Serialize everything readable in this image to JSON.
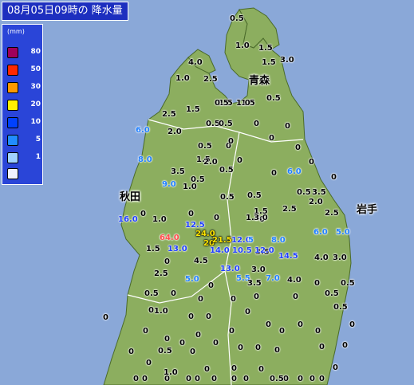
{
  "title": "08月05日09時の 降水量",
  "legend": {
    "unit": "(mm)",
    "items": [
      {
        "label": "80",
        "color": "#a0005a"
      },
      {
        "label": "50",
        "color": "#ff2800"
      },
      {
        "label": "30",
        "color": "#ff9900"
      },
      {
        "label": "20",
        "color": "#fff000"
      },
      {
        "label": "10",
        "color": "#0041ff"
      },
      {
        "label": "5",
        "color": "#218cff"
      },
      {
        "label": "1",
        "color": "#a0d2ff"
      },
      {
        "label": "",
        "color": "#f2f2ff"
      }
    ]
  },
  "places": [
    {
      "name": "青森"
    },
    {
      "name": "秋田"
    },
    {
      "name": "岩手"
    }
  ],
  "observations": [
    {
      "v": "0.5"
    },
    {
      "v": "1.0"
    },
    {
      "v": "1.5"
    },
    {
      "v": "3.0"
    },
    {
      "v": "4.0"
    },
    {
      "v": "1.5"
    },
    {
      "v": "1.0"
    },
    {
      "v": "2.5"
    },
    {
      "v": "0"
    },
    {
      "v": "1.5"
    },
    {
      "v": "2.5"
    },
    {
      "v": "1.5"
    },
    {
      "v": "1.5"
    },
    {
      "v": "0.5"
    },
    {
      "v": "1.0"
    },
    {
      "v": "0.5"
    },
    {
      "v": "0.5"
    },
    {
      "v": "0.5"
    },
    {
      "v": "0"
    },
    {
      "v": "6.0"
    },
    {
      "v": "2.0"
    },
    {
      "v": "0.5"
    },
    {
      "v": "0"
    },
    {
      "v": "0"
    },
    {
      "v": "0"
    },
    {
      "v": "0"
    },
    {
      "v": "8.0"
    },
    {
      "v": "1.5"
    },
    {
      "v": "0"
    },
    {
      "v": "2.0"
    },
    {
      "v": "0.5"
    },
    {
      "v": "0"
    },
    {
      "v": "3.5"
    },
    {
      "v": "9.0"
    },
    {
      "v": "1.0"
    },
    {
      "v": "0.5"
    },
    {
      "v": "0"
    },
    {
      "v": "6.0"
    },
    {
      "v": "0"
    },
    {
      "v": "0.5"
    },
    {
      "v": "0.5"
    },
    {
      "v": "0.5"
    },
    {
      "v": "3.5"
    },
    {
      "v": "2.0"
    },
    {
      "v": "0"
    },
    {
      "v": "0"
    },
    {
      "v": "1.5"
    },
    {
      "v": "2.5"
    },
    {
      "v": "2.5"
    },
    {
      "v": "0"
    },
    {
      "v": "1.3"
    },
    {
      "v": "3.0"
    },
    {
      "v": "16.0"
    },
    {
      "v": "1.0"
    },
    {
      "v": "12.5"
    },
    {
      "v": "0"
    },
    {
      "v": "6.0"
    },
    {
      "v": "5.0"
    },
    {
      "v": "64.0"
    },
    {
      "v": "24.0"
    },
    {
      "v": "20"
    },
    {
      "v": "21.5"
    },
    {
      "v": "12.0"
    },
    {
      "v": "5"
    },
    {
      "v": "8.0"
    },
    {
      "v": "3.5"
    },
    {
      "v": "1.5"
    },
    {
      "v": "13.0"
    },
    {
      "v": "14.0"
    },
    {
      "v": "10.5"
    },
    {
      "v": "12.0"
    },
    {
      "v": "4.0"
    },
    {
      "v": "3.0"
    },
    {
      "v": "0"
    },
    {
      "v": "4.5"
    },
    {
      "v": "14.5"
    },
    {
      "v": "0"
    },
    {
      "v": "2.5"
    },
    {
      "v": "13.0"
    },
    {
      "v": "3.0"
    },
    {
      "v": "5.5"
    },
    {
      "v": "7.0"
    },
    {
      "v": "4.0"
    },
    {
      "v": "0.5"
    },
    {
      "v": "5.0"
    },
    {
      "v": "3.5"
    },
    {
      "v": "0"
    },
    {
      "v": "0.5"
    },
    {
      "v": "0"
    },
    {
      "v": "0"
    },
    {
      "v": "0"
    },
    {
      "v": "0"
    },
    {
      "v": "0"
    },
    {
      "v": "0"
    },
    {
      "v": "0.5"
    },
    {
      "v": "1.0"
    },
    {
      "v": "0"
    },
    {
      "v": "0"
    },
    {
      "v": "0"
    },
    {
      "v": "0"
    },
    {
      "v": "0.5"
    },
    {
      "v": "0"
    },
    {
      "v": "0"
    },
    {
      "v": "0"
    },
    {
      "v": "0"
    },
    {
      "v": "0"
    },
    {
      "v": "0"
    },
    {
      "v": "0"
    },
    {
      "v": "0"
    },
    {
      "v": "0"
    },
    {
      "v": "0"
    },
    {
      "v": "0"
    },
    {
      "v": "0"
    },
    {
      "v": "0"
    },
    {
      "v": "0"
    },
    {
      "v": "0"
    },
    {
      "v": "0.5"
    },
    {
      "v": "0"
    },
    {
      "v": "0"
    },
    {
      "v": "0"
    },
    {
      "v": "0"
    },
    {
      "v": "0"
    },
    {
      "v": "0"
    },
    {
      "v": "0"
    },
    {
      "v": "0"
    },
    {
      "v": "0"
    },
    {
      "v": "0"
    },
    {
      "v": "0"
    },
    {
      "v": "0.5"
    },
    {
      "v": "0"
    },
    {
      "v": "0"
    },
    {
      "v": "0"
    },
    {
      "v": "1.0"
    },
    {
      "v": "0"
    },
    {
      "v": "0"
    },
    {
      "v": "0"
    },
    {
      "v": "0"
    },
    {
      "v": "0"
    },
    {
      "v": "0"
    }
  ]
}
